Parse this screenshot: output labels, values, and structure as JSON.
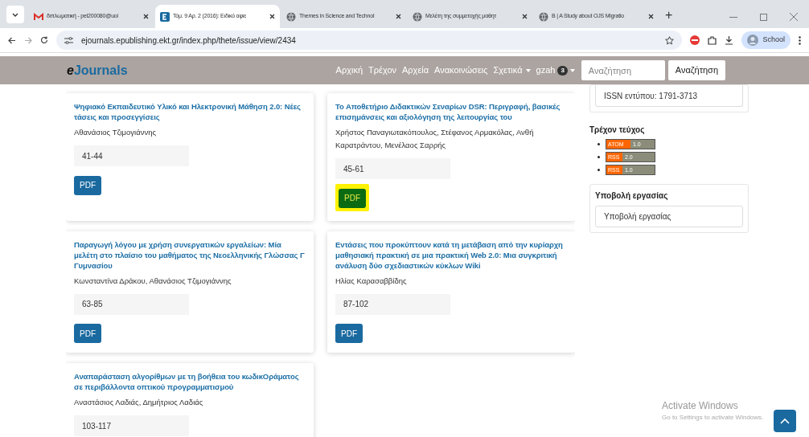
{
  "browser": {
    "tabs": [
      {
        "title": "διπλωματική - pel200080@uoi",
        "selected": false
      },
      {
        "title": "Τόμ. 9 Αρ. 2 (2016): Ειδικό αφιε",
        "selected": true
      },
      {
        "title": "Themes in Science and Technol",
        "selected": false
      },
      {
        "title": "Μελέτη της συμμετοχής μαθητ",
        "selected": false
      },
      {
        "title": "B | A Study about OJS Migratio",
        "selected": false
      }
    ],
    "new_tab": "+",
    "url": "ejournals.epublishing.ekt.gr/index.php/thete/issue/view/2434",
    "profile": "School"
  },
  "navbar": {
    "logo_prefix": "e",
    "logo": "Journals",
    "items": [
      {
        "label": "Αρχική",
        "dropdown": false
      },
      {
        "label": "Τρέχον",
        "dropdown": false
      },
      {
        "label": "Αρχεία",
        "dropdown": false
      },
      {
        "label": "Ανακοινώσεις",
        "dropdown": false
      },
      {
        "label": "Σχετικά",
        "dropdown": true
      }
    ],
    "user": "gzah",
    "user_badge": "3",
    "search_placeholder": "Αναζήτηση",
    "search_button": "Αναζήτηση"
  },
  "articles": [
    {
      "title": "Ψηφιακό Εκπαιδευτικό Υλικό και Ηλεκτρονική Μάθηση 2.0: Νέες τάσεις και προσεγγίσεις",
      "authors": "Αθανάσιος Τζιμογιάννης",
      "pages": "41-44",
      "button": "PDF",
      "highlighted": false
    },
    {
      "title": "Το Αποθετήριο Διδακτικών Σεναρίων DSR: Περιγραφή, βασικές επισημάνσεις και αξιολόγηση της λειτουργίας του",
      "authors": "Χρήστος Παναγιωτακόπουλος, Στέφανος Αρμακόλας, Ανθή Καρατράντου, Μενέλαος Σαρρής",
      "pages": "45-61",
      "button": "PDF",
      "highlighted": true
    },
    {
      "title": "Παραγωγή λόγου με χρήση συνεργατικών εργαλείων: Μία μελέτη στο πλαίσιο του μαθήματος της Νεοελληνικής Γλώσσας Γ Γυμνασίου",
      "authors": "Κωνσταντίνα Δράκου, Αθανάσιος Τζιμογιάννης",
      "pages": "63-85",
      "button": "PDF",
      "highlighted": false
    },
    {
      "title": "Εντάσεις που προκύπτουν κατά τη μετάβαση από την κυρίαρχη μαθησιακή πρακτική σε μια πρακτική Web 2.0: Μια συγκριτική ανάλυση δύο σχεδιαστικών κύκλων Wiki",
      "authors": "Ηλίας Καρασαββίδης",
      "pages": "87-102",
      "button": "PDF",
      "highlighted": false
    },
    {
      "title": "Αναπαράσταση αλγορίθμων με τη βοήθεια του κωδικΟράματος σε περιβάλλοντα οπτικού προγραμματισμού",
      "authors": "Αναστάσιος Λαδιάς, Δημήτριος Λαδιάς",
      "pages": "103-117"
    }
  ],
  "sidebar": {
    "issn": "ISSN εντύπου: 1791-3713",
    "current_issue": "Τρέχον τεύχος",
    "feeds": [
      {
        "kind": "ATOM",
        "version": "1.0"
      },
      {
        "kind": "RSS",
        "version": "2.0"
      },
      {
        "kind": "RSS",
        "version": "1.0"
      }
    ],
    "submission_title": "Υποβολή εργασίας",
    "submission_link": "Υποβολή εργασίας"
  },
  "windows_notice": {
    "title": "Activate Windows",
    "subtitle": "Go to Settings to activate Windows."
  }
}
